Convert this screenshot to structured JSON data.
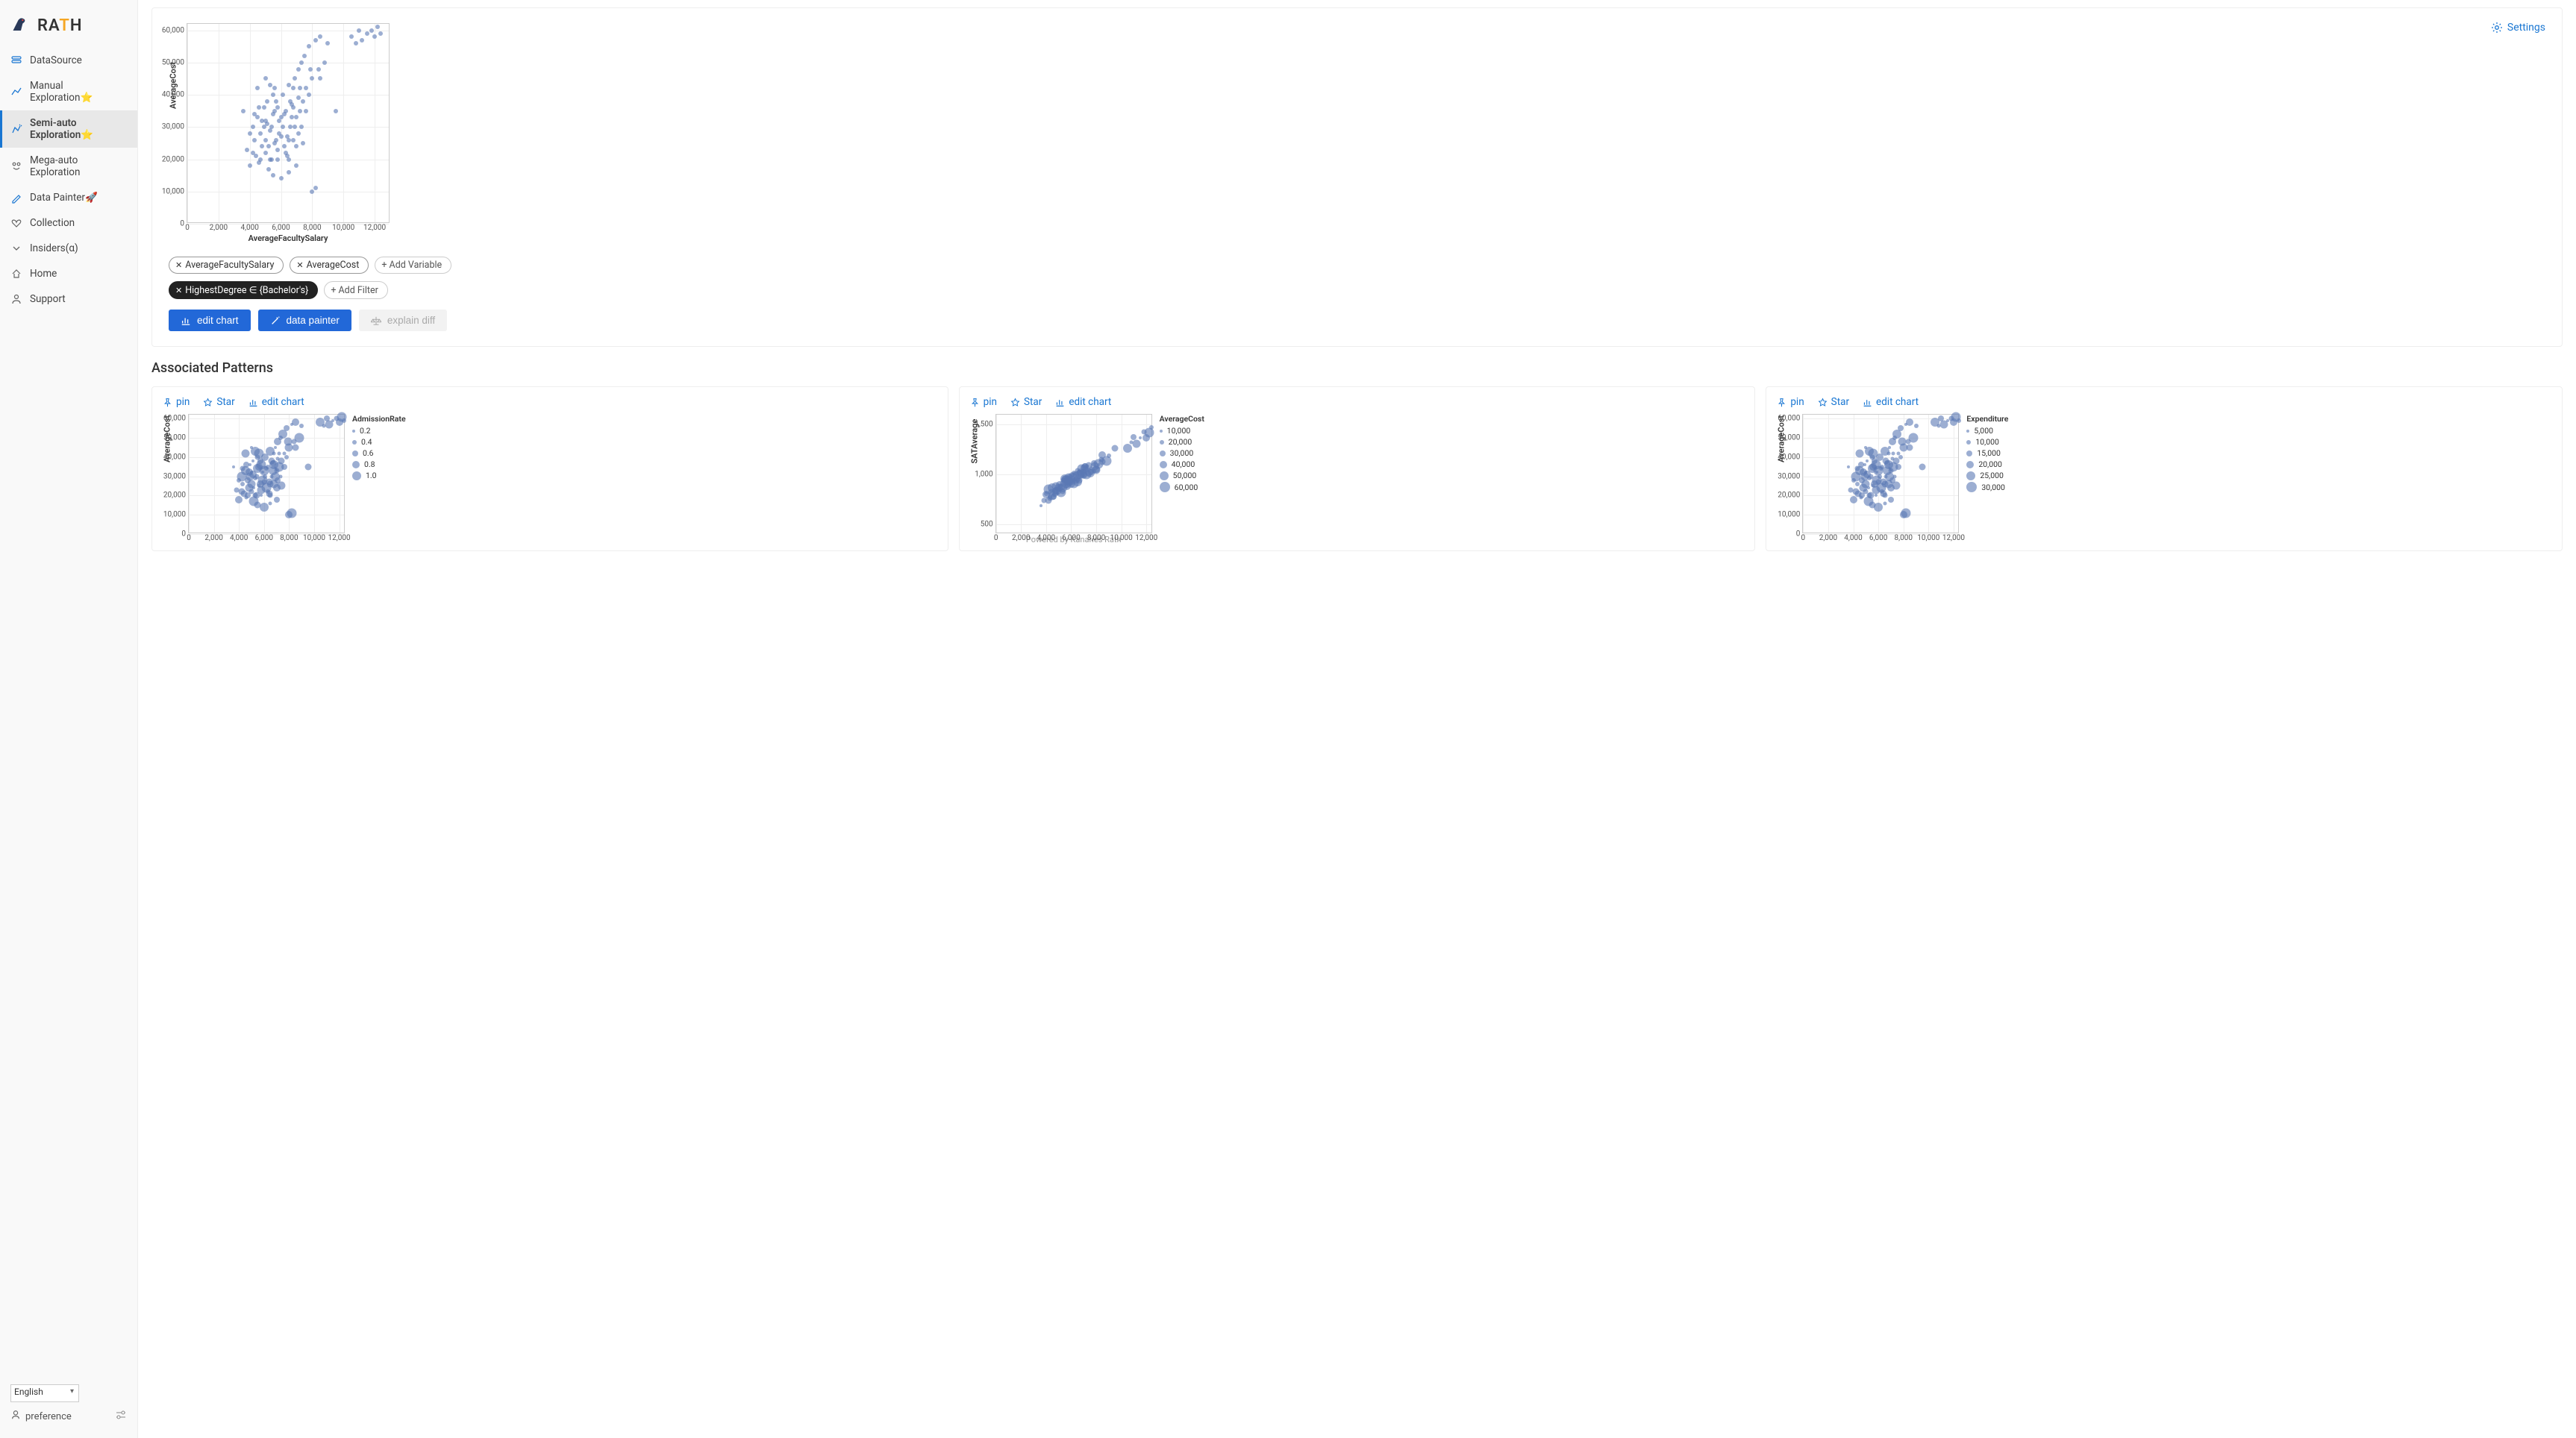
{
  "brand": "RATH",
  "sidebar": {
    "items": [
      {
        "label": "DataSource",
        "icon": "database"
      },
      {
        "label": "Manual Exploration⭐",
        "icon": "linechart"
      },
      {
        "label": "Semi-auto Exploration⭐",
        "icon": "sparkle",
        "active": true
      },
      {
        "label": "Mega-auto Exploration",
        "icon": "robot"
      },
      {
        "label": "Data Painter🚀",
        "icon": "pencil"
      },
      {
        "label": "Collection",
        "icon": "heart"
      },
      {
        "label": "Insiders(α)",
        "icon": "chevron"
      },
      {
        "label": "Home",
        "icon": "home"
      },
      {
        "label": "Support",
        "icon": "person"
      }
    ],
    "language": "English",
    "preference_label": "preference"
  },
  "header": {
    "settings_label": "Settings"
  },
  "variables": [
    {
      "label": "AverageFacultySalary"
    },
    {
      "label": "AverageCost"
    }
  ],
  "add_variable_label": "+ Add Variable",
  "filters": [
    {
      "label": "HighestDegree ∈ {Bachelor's}"
    }
  ],
  "add_filter_label": "+ Add Filter",
  "buttons": {
    "edit_chart": "edit chart",
    "data_painter": "data painter",
    "explain_diff": "explain diff"
  },
  "associated_title": "Associated Patterns",
  "pattern_actions": {
    "pin": "pin",
    "star": "Star",
    "edit": "edit chart"
  },
  "powered_by": "Powered by Kanaries Rath",
  "chart_data": [
    {
      "type": "scatter",
      "xlabel": "AverageFacultySalary",
      "ylabel": "AverageCost",
      "xlim": [
        0,
        13000
      ],
      "ylim": [
        0,
        62000
      ],
      "xticks": [
        0,
        2000,
        4000,
        6000,
        8000,
        10000,
        12000
      ],
      "yticks": [
        0,
        10000,
        20000,
        30000,
        40000,
        50000,
        60000
      ],
      "points": [
        [
          3600,
          35000
        ],
        [
          3800,
          23000
        ],
        [
          4000,
          18000
        ],
        [
          4200,
          30000
        ],
        [
          4300,
          26000
        ],
        [
          4400,
          21000
        ],
        [
          4500,
          33000
        ],
        [
          4600,
          19000
        ],
        [
          4700,
          28000
        ],
        [
          4800,
          24000
        ],
        [
          4900,
          36000
        ],
        [
          5000,
          22000
        ],
        [
          5100,
          31000
        ],
        [
          5200,
          17000
        ],
        [
          5300,
          29000
        ],
        [
          5400,
          20000
        ],
        [
          5500,
          34000
        ],
        [
          5600,
          25000
        ],
        [
          5700,
          38000
        ],
        [
          5800,
          23000
        ],
        [
          5900,
          32000
        ],
        [
          6000,
          27000
        ],
        [
          6100,
          40000
        ],
        [
          6200,
          24000
        ],
        [
          6300,
          35000
        ],
        [
          6400,
          21000
        ],
        [
          6500,
          43000
        ],
        [
          6600,
          30000
        ],
        [
          6700,
          37000
        ],
        [
          6800,
          26000
        ],
        [
          6900,
          45000
        ],
        [
          7000,
          33000
        ],
        [
          7100,
          48000
        ],
        [
          7200,
          35000
        ],
        [
          7300,
          50000
        ],
        [
          7400,
          38000
        ],
        [
          7500,
          52000
        ],
        [
          7600,
          42000
        ],
        [
          7800,
          55000
        ],
        [
          8000,
          45000
        ],
        [
          8200,
          57000
        ],
        [
          8400,
          48000
        ],
        [
          8500,
          58000
        ],
        [
          8800,
          50000
        ],
        [
          9000,
          56000
        ],
        [
          9500,
          35000
        ],
        [
          10500,
          58000
        ],
        [
          10800,
          56000
        ],
        [
          11000,
          60000
        ],
        [
          11200,
          57000
        ],
        [
          11500,
          59000
        ],
        [
          11800,
          60000
        ],
        [
          12000,
          58000
        ],
        [
          12200,
          61000
        ],
        [
          12400,
          59000
        ],
        [
          5500,
          15000
        ],
        [
          6000,
          14000
        ],
        [
          6500,
          16000
        ],
        [
          7000,
          18000
        ],
        [
          4500,
          42000
        ],
        [
          5000,
          45000
        ],
        [
          5500,
          40000
        ],
        [
          8000,
          10000
        ],
        [
          8200,
          11000
        ],
        [
          4000,
          28000
        ],
        [
          4200,
          22000
        ],
        [
          5300,
          43000
        ],
        [
          6800,
          42000
        ],
        [
          7100,
          28000
        ],
        [
          7400,
          25000
        ],
        [
          5100,
          38000
        ],
        [
          5400,
          30000
        ],
        [
          5700,
          26000
        ],
        [
          6000,
          33000
        ],
        [
          6300,
          22000
        ],
        [
          6600,
          38000
        ],
        [
          6900,
          30000
        ],
        [
          7200,
          42000
        ],
        [
          4600,
          36000
        ],
        [
          4900,
          30000
        ],
        [
          5200,
          24000
        ],
        [
          6500,
          20000
        ],
        [
          7000,
          24000
        ],
        [
          5800,
          36000
        ],
        [
          6100,
          30000
        ],
        [
          6400,
          27000
        ],
        [
          6700,
          33000
        ],
        [
          7300,
          30000
        ],
        [
          7600,
          35000
        ],
        [
          7900,
          48000
        ],
        [
          5000,
          32000
        ],
        [
          5300,
          20000
        ],
        [
          5600,
          35000
        ],
        [
          5900,
          28000
        ],
        [
          6200,
          34000
        ],
        [
          6500,
          26000
        ],
        [
          6800,
          36000
        ],
        [
          7100,
          39000
        ],
        [
          4700,
          20000
        ],
        [
          5000,
          26000
        ],
        [
          5800,
          20000
        ],
        [
          4300,
          34000
        ],
        [
          4800,
          32000
        ],
        [
          5600,
          42000
        ],
        [
          7800,
          40000
        ],
        [
          8500,
          45000
        ]
      ]
    },
    {
      "type": "scatter",
      "xlabel": "",
      "ylabel": "AverageCost",
      "xlim": [
        0,
        12500
      ],
      "ylim": [
        0,
        62000
      ],
      "xticks": [
        0,
        2000,
        4000,
        6000,
        8000,
        10000,
        12000
      ],
      "yticks": [
        0,
        10000,
        20000,
        30000,
        40000,
        50000,
        60000
      ],
      "size_field": "AdmissionRate",
      "legend": {
        "title": "AdmissionRate",
        "items": [
          "0.2",
          "0.4",
          "0.6",
          "0.8",
          "1.0"
        ],
        "sizes": [
          4,
          6,
          8,
          10,
          12
        ]
      }
    },
    {
      "type": "scatter",
      "xlabel": "",
      "ylabel": "SATAverage",
      "xlim": [
        0,
        12500
      ],
      "ylim": [
        400,
        1600
      ],
      "xticks": [
        0,
        2000,
        4000,
        6000,
        8000,
        10000,
        12000
      ],
      "yticks": [
        500,
        1000,
        1500
      ],
      "size_field": "AverageCost",
      "legend": {
        "title": "AverageCost",
        "items": [
          "10,000",
          "20,000",
          "30,000",
          "40,000",
          "50,000",
          "60,000"
        ],
        "sizes": [
          4,
          6,
          8,
          10,
          12,
          14
        ]
      }
    },
    {
      "type": "scatter",
      "xlabel": "",
      "ylabel": "AverageCost",
      "xlim": [
        0,
        12500
      ],
      "ylim": [
        0,
        62000
      ],
      "xticks": [
        0,
        2000,
        4000,
        6000,
        8000,
        10000,
        12000
      ],
      "yticks": [
        0,
        10000,
        20000,
        30000,
        40000,
        50000,
        60000
      ],
      "size_field": "Expenditure",
      "legend": {
        "title": "Expenditure",
        "items": [
          "5,000",
          "10,000",
          "15,000",
          "20,000",
          "25,000",
          "30,000"
        ],
        "sizes": [
          4,
          6,
          8,
          10,
          12,
          14
        ]
      }
    }
  ]
}
